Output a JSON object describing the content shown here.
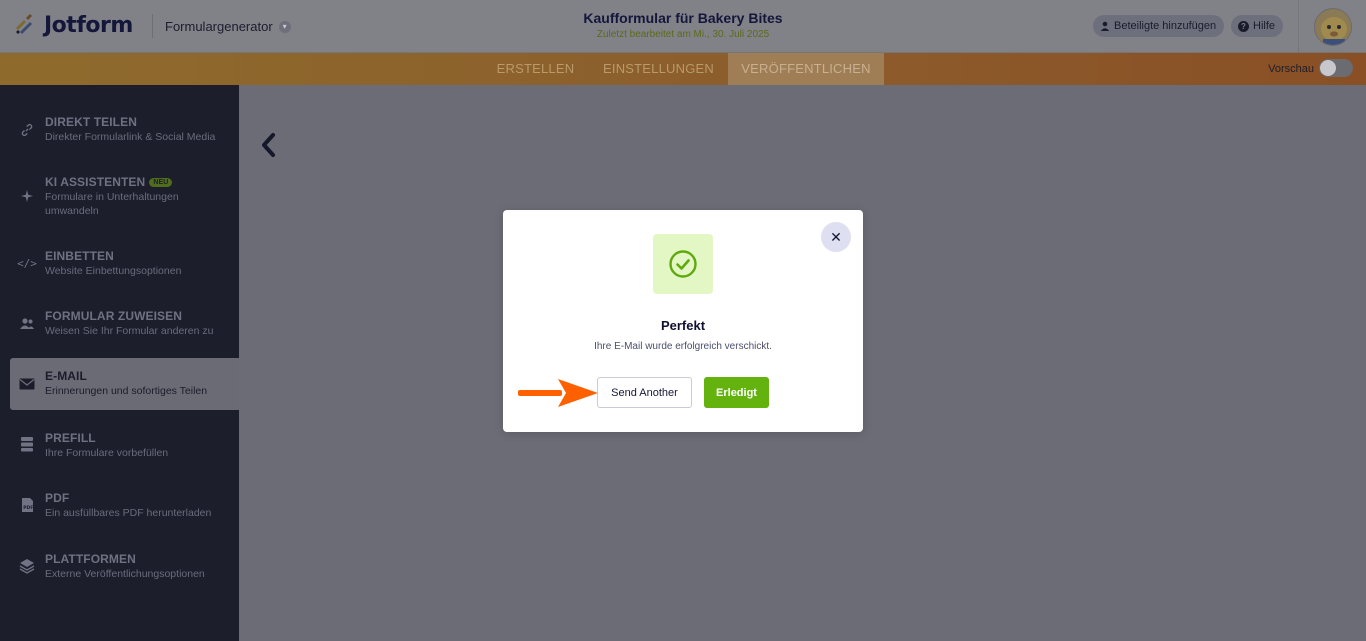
{
  "header": {
    "brand": "Jotform",
    "form_generator": "Formulargenerator",
    "form_title": "Kaufformular für Bakery Bites",
    "last_edited": "Zuletzt bearbeitet am Mi., 30. Juli 2025",
    "add_participants": "Beteiligte hinzufügen",
    "help": "Hilfe"
  },
  "nav": {
    "tabs": [
      {
        "label": "ERSTELLEN"
      },
      {
        "label": "EINSTELLUNGEN"
      },
      {
        "label": "VERÖFFENTLICHEN"
      }
    ],
    "preview": "Vorschau"
  },
  "sidebar": {
    "items": [
      {
        "title": "DIREKT TEILEN",
        "desc": "Direkter Formularlink & Social Media",
        "icon": "link-icon"
      },
      {
        "title": "KI ASSISTENTEN",
        "badge": "NEU",
        "desc": "Formulare in Unterhaltungen umwandeln",
        "icon": "sparkle-icon"
      },
      {
        "title": "EINBETTEN",
        "desc": "Website Einbettungsoptionen",
        "icon": "code-icon"
      },
      {
        "title": "FORMULAR ZUWEISEN",
        "desc": "Weisen Sie Ihr Formular anderen zu",
        "icon": "users-icon"
      },
      {
        "title": "E-MAIL",
        "desc": "Erinnerungen und sofortiges Teilen",
        "icon": "mail-icon"
      },
      {
        "title": "PREFILL",
        "desc": "Ihre Formulare vorbefüllen",
        "icon": "prefill-icon"
      },
      {
        "title": "PDF",
        "desc": "Ein ausfüllbares PDF herunterladen",
        "icon": "pdf-icon"
      },
      {
        "title": "PLATTFORMEN",
        "desc": "Externe Veröffentlichungsoptionen",
        "icon": "layers-icon"
      }
    ]
  },
  "modal": {
    "title": "Perfekt",
    "message": "Ihre E-Mail wurde erfolgreich verschickt.",
    "send_another": "Send Another",
    "done": "Erledigt"
  },
  "colors": {
    "accent_orange": "#ff6100",
    "success_green": "#64b20e",
    "sidebar_bg": "#1c1e2c"
  }
}
